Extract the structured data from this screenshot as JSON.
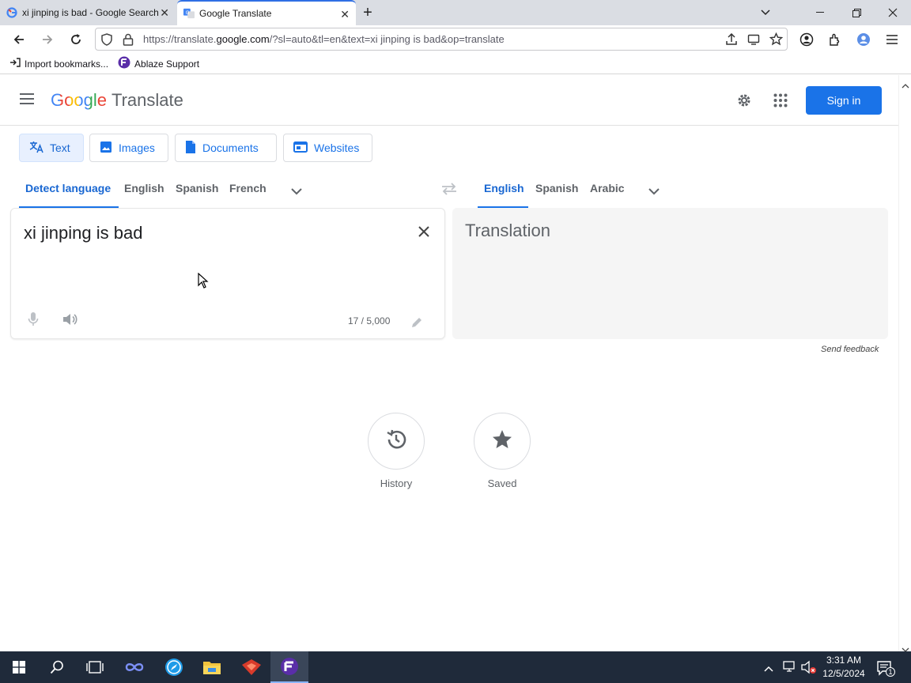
{
  "browser": {
    "tabs": [
      {
        "title": "xi jinping is bad - Google Search",
        "icon": "google-g-icon"
      },
      {
        "title": "Google Translate",
        "icon": "google-translate-icon",
        "active": true
      }
    ],
    "url_prefix": "https://translate.",
    "url_domain": "google.com",
    "url_suffix": "/?sl=auto&tl=en&text=xi jinping is bad&op=translate",
    "bookmarks": [
      {
        "label": "Import bookmarks...",
        "icon": "import-icon"
      },
      {
        "label": "Ablaze Support",
        "icon": "ablaze-icon"
      }
    ]
  },
  "translate": {
    "logo_google": "Google",
    "logo_translate": "Translate",
    "signin_label": "Sign in",
    "modes": [
      {
        "label": "Text",
        "icon": "translate-icon"
      },
      {
        "label": "Images",
        "icon": "image-icon"
      },
      {
        "label": "Documents",
        "icon": "document-icon"
      },
      {
        "label": "Websites",
        "icon": "website-icon"
      }
    ],
    "source_langs": [
      "Detect language",
      "English",
      "Spanish",
      "French"
    ],
    "target_langs": [
      "English",
      "Spanish",
      "Arabic"
    ],
    "source_text": "xi jinping is bad",
    "char_count": "17 / 5,000",
    "target_placeholder": "Translation",
    "send_feedback": "Send feedback",
    "history_label": "History",
    "saved_label": "Saved"
  },
  "taskbar": {
    "time": "3:31 AM",
    "date": "12/5/2024",
    "notification_count": "1"
  },
  "colors": {
    "accent": "#1a73e8",
    "taskbar": "#1f2a3a",
    "tabbar": "#dadde3"
  }
}
